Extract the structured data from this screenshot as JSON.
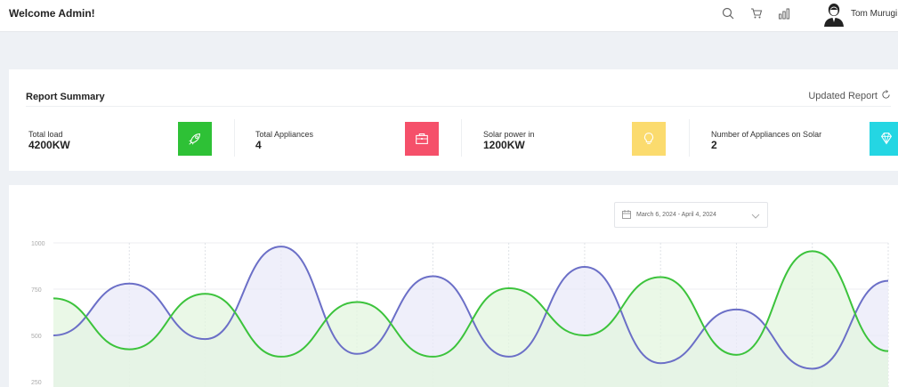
{
  "header": {
    "welcome": "Welcome Admin!",
    "icons": [
      "search-icon",
      "cart-icon",
      "bar-chart-icon"
    ],
    "user_name": "Tom Murugi"
  },
  "summary": {
    "title": "Report Summary",
    "updated_label": "Updated Report",
    "stats": [
      {
        "label": "Total load",
        "value": "4200KW",
        "color": "#2ec136",
        "icon": "rocket-icon"
      },
      {
        "label": "Total Appliances",
        "value": "4",
        "color": "#f5506a",
        "icon": "briefcase-icon"
      },
      {
        "label": "Solar power in",
        "value": "1200KW",
        "color": "#fbdb6e",
        "icon": "lightbulb-icon"
      },
      {
        "label": "Number of Appliances on Solar",
        "value": "2",
        "color": "#24d6e3",
        "icon": "diamond-icon"
      }
    ]
  },
  "date_range": {
    "label": "March 6, 2024 - April 4, 2024",
    "icons": [
      "calendar-icon",
      "chevron-down-icon"
    ]
  },
  "chart_data": {
    "type": "area",
    "ylim": [
      250,
      1000
    ],
    "y_ticks": [
      "1000",
      "750",
      "500",
      "250"
    ],
    "grid": true,
    "series": [
      {
        "color": "#6b6fc7",
        "fill": "#e9eaf8",
        "values": [
          500,
          780,
          480,
          980,
          400,
          820,
          385,
          870,
          350,
          640,
          320,
          795
        ]
      },
      {
        "color": "#3cc33c",
        "fill": "#e3f6df",
        "values": [
          700,
          425,
          725,
          385,
          680,
          385,
          755,
          500,
          815,
          395,
          955,
          415
        ]
      }
    ]
  }
}
